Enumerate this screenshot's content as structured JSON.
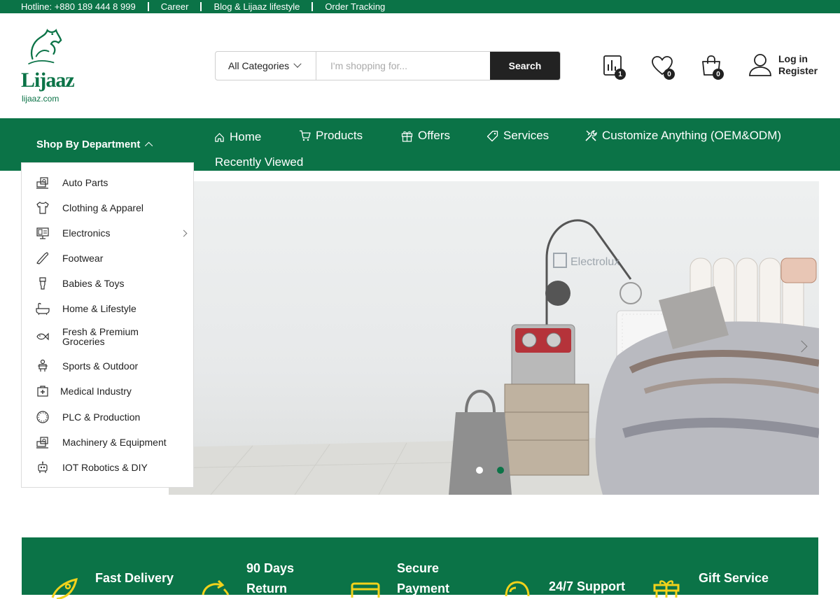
{
  "topbar": {
    "hotline": "Hotline: +880 189 444 8 999",
    "links": [
      "Career",
      "Blog & Lijaaz lifestyle",
      "Order Tracking"
    ]
  },
  "brand": {
    "name": "Lijaaz",
    "url": "lijaaz.com",
    "color": "#0b7347"
  },
  "search": {
    "category": "All Categories",
    "placeholder": "I'm shopping for...",
    "button": "Search"
  },
  "header_icons": {
    "compare_count": "1",
    "wishlist_count": "0",
    "cart_count": "0",
    "login": "Log in",
    "register": "Register"
  },
  "nav": {
    "department": "Shop By Department",
    "items": [
      "Home",
      "Products",
      "Offers",
      "Services",
      "Customize Anything (OEM&ODM)",
      "Recently Viewed"
    ]
  },
  "departments": [
    "Auto Parts",
    "Clothing & Apparel",
    "Electronics",
    "Footwear",
    "Babies & Toys",
    "Home & Lifestyle",
    "Fresh & Premium Groceries",
    "Sports & Outdoor",
    "Medical Industry",
    "PLC & Production",
    "Machinery & Equipment",
    "IOT Robotics & DIY"
  ],
  "banner": {
    "brand_text": "Electrolux",
    "slides": 2,
    "active_slide": 2
  },
  "features": [
    "Fast Delivery",
    "90 Days Return",
    "Secure Payment",
    "24/7 Support",
    "Gift Service"
  ]
}
